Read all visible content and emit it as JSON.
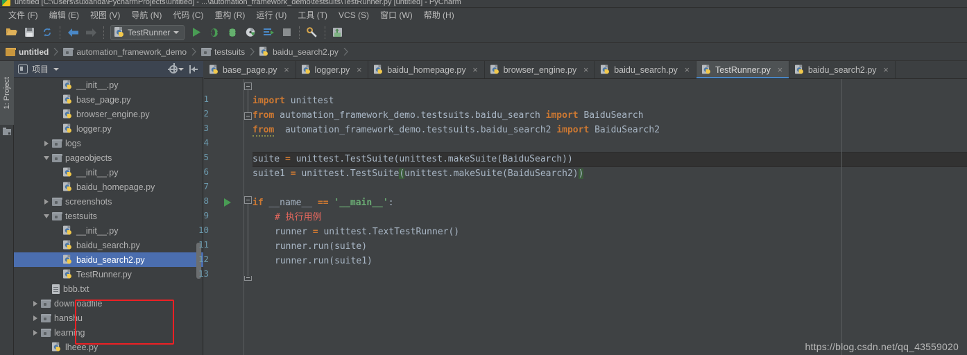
{
  "window": {
    "title": "untitled [C:\\Users\\suxianda\\PycharmProjects\\untitled] - ...\\automation_framework_demo\\testsuits\\TestRunner.py [untitled] - PyCharm",
    "logo_icon": "pycharm-logo-icon"
  },
  "menubar": {
    "items": [
      {
        "label": "文件 (F)"
      },
      {
        "label": "编辑 (E)"
      },
      {
        "label": "视图 (V)"
      },
      {
        "label": "导航 (N)"
      },
      {
        "label": "代码 (C)"
      },
      {
        "label": "重构 (R)"
      },
      {
        "label": "运行 (U)"
      },
      {
        "label": "工具 (T)"
      },
      {
        "label": "VCS (S)"
      },
      {
        "label": "窗口 (W)"
      },
      {
        "label": "帮助 (H)"
      }
    ]
  },
  "toolbar": {
    "run_config": {
      "label": "TestRunner",
      "icon": "python-file-icon",
      "caret": "chevron-down-icon"
    },
    "buttons": [
      {
        "name": "open-folder-icon"
      },
      {
        "name": "save-all-icon"
      },
      {
        "name": "sync-refresh-icon"
      },
      {
        "name": "back-arrow-icon"
      },
      {
        "name": "forward-arrow-icon"
      },
      {
        "name": "run-icon"
      },
      {
        "name": "debug-icon"
      },
      {
        "name": "coverage-icon"
      },
      {
        "name": "profile-icon"
      },
      {
        "name": "run-with-console-icon"
      },
      {
        "name": "stop-icon"
      },
      {
        "name": "settings-wrench-icon"
      },
      {
        "name": "vcs-update-icon"
      }
    ]
  },
  "breadcrumb": {
    "items": [
      {
        "label": "untitled",
        "icon": "folder-open-icon"
      },
      {
        "label": "automation_framework_demo",
        "icon": "folder-icon"
      },
      {
        "label": "testsuits",
        "icon": "folder-icon"
      },
      {
        "label": "baidu_search2.py",
        "icon": "python-file-icon"
      }
    ]
  },
  "toolstrip": {
    "project_button": "1: Project",
    "project_button_num": "1",
    "project_button_rest": ": Project",
    "structure_icon": "folder-tool-icon"
  },
  "project_panel": {
    "title": "项目",
    "header_icon": "project-view-icon",
    "gear_icon": "gear-icon",
    "collapse_icon": "collapse-all-icon",
    "tree": [
      {
        "label": "__init__.py",
        "icon": "python-file-icon",
        "indent": 4,
        "twisty": "none",
        "selected": false
      },
      {
        "label": "base_page.py",
        "icon": "python-file-icon",
        "indent": 4,
        "twisty": "none",
        "selected": false
      },
      {
        "label": "browser_engine.py",
        "icon": "python-file-icon",
        "indent": 4,
        "twisty": "none",
        "selected": false
      },
      {
        "label": "logger.py",
        "icon": "python-file-icon",
        "indent": 4,
        "twisty": "none",
        "selected": false
      },
      {
        "label": "logs",
        "icon": "folder-icon",
        "indent": 3,
        "twisty": "right",
        "selected": false
      },
      {
        "label": "pageobjects",
        "icon": "folder-icon",
        "indent": 3,
        "twisty": "down",
        "selected": false
      },
      {
        "label": "__init__.py",
        "icon": "python-file-icon",
        "indent": 4,
        "twisty": "none",
        "selected": false
      },
      {
        "label": "baidu_homepage.py",
        "icon": "python-file-icon",
        "indent": 4,
        "twisty": "none",
        "selected": false
      },
      {
        "label": "screenshots",
        "icon": "folder-icon",
        "indent": 3,
        "twisty": "right",
        "selected": false
      },
      {
        "label": "testsuits",
        "icon": "folder-icon",
        "indent": 3,
        "twisty": "down",
        "selected": false
      },
      {
        "label": "__init__.py",
        "icon": "python-file-icon",
        "indent": 4,
        "twisty": "none",
        "selected": false
      },
      {
        "label": "baidu_search.py",
        "icon": "python-file-icon",
        "indent": 4,
        "twisty": "none",
        "selected": false
      },
      {
        "label": "baidu_search2.py",
        "icon": "python-file-icon",
        "indent": 4,
        "twisty": "none",
        "selected": true
      },
      {
        "label": "TestRunner.py",
        "icon": "python-file-icon",
        "indent": 4,
        "twisty": "none",
        "selected": false
      },
      {
        "label": "bbb.txt",
        "icon": "text-file-icon",
        "indent": 3,
        "twisty": "none",
        "selected": false
      },
      {
        "label": "downloadfile",
        "icon": "folder-icon",
        "indent": 2,
        "twisty": "right",
        "selected": false
      },
      {
        "label": "hanshu",
        "icon": "folder-icon",
        "indent": 2,
        "twisty": "right",
        "selected": false
      },
      {
        "label": "learning",
        "icon": "folder-icon",
        "indent": 2,
        "twisty": "right",
        "selected": false
      },
      {
        "label": "lheee.py",
        "icon": "python-file-icon",
        "indent": 3,
        "twisty": "none",
        "selected": false
      }
    ],
    "annotation": {
      "color": "#ed2024",
      "name": "red-highlight-box"
    }
  },
  "editor_tabs": [
    {
      "label": "base_page.py",
      "icon": "python-file-icon",
      "active": false,
      "close": "×"
    },
    {
      "label": "logger.py",
      "icon": "python-file-icon",
      "active": false,
      "close": "×"
    },
    {
      "label": "baidu_homepage.py",
      "icon": "python-file-icon",
      "active": false,
      "close": "×"
    },
    {
      "label": "browser_engine.py",
      "icon": "python-file-icon",
      "active": false,
      "close": "×"
    },
    {
      "label": "baidu_search.py",
      "icon": "python-file-icon",
      "active": false,
      "close": "×"
    },
    {
      "label": "TestRunner.py",
      "icon": "python-file-icon",
      "active": true,
      "close": "×"
    },
    {
      "label": "baidu_search2.py",
      "icon": "python-file-icon",
      "active": false,
      "close": "×"
    }
  ],
  "editor": {
    "line_numbers": [
      "1",
      "2",
      "3",
      "4",
      "5",
      "6",
      "7",
      "8",
      "9",
      "10",
      "11",
      "12",
      "13"
    ],
    "current_line": 6,
    "run_marker_line": 8,
    "lines": [
      {
        "n": 1,
        "text": "import unittest"
      },
      {
        "n": 2,
        "text": "from automation_framework_demo.testsuits.baidu_search import BaiduSearch"
      },
      {
        "n": 3,
        "text": "from  automation_framework_demo.testsuits.baidu_search2 import BaiduSearch2"
      },
      {
        "n": 4,
        "text": ""
      },
      {
        "n": 5,
        "text": "suite = unittest.TestSuite(unittest.makeSuite(BaiduSearch))"
      },
      {
        "n": 6,
        "text": "suite1 = unittest.TestSuite(unittest.makeSuite(BaiduSearch2))"
      },
      {
        "n": 7,
        "text": ""
      },
      {
        "n": 8,
        "text": "if __name__ == '__main__':"
      },
      {
        "n": 9,
        "text": "    # 执行用例"
      },
      {
        "n": 10,
        "text": "    runner = unittest.TextTestRunner()"
      },
      {
        "n": 11,
        "text": "    runner.run(suite)"
      },
      {
        "n": 12,
        "text": "    runner.run(suite1)"
      },
      {
        "n": 13,
        "text": ""
      }
    ],
    "tokens": {
      "import": "import",
      "from": "from",
      "if": "if",
      "unittest": "unittest",
      "module2": "automation_framework_demo.testsuits.baidu_search",
      "class2": "BaiduSearch",
      "module3": "automation_framework_demo.testsuits.baidu_search2",
      "class3": "BaiduSearch2",
      "suite_name": "suite",
      "suite1_name": "suite1",
      "eq": "=",
      "testsuite_call": "unittest.TestSuite",
      "makesuite_call_a": "unittest.makeSuite(BaiduSearch)",
      "makesuite_call_b": "unittest.makeSuite(BaiduSearch2)",
      "dunder_name": "__name__",
      "eqeq": "==",
      "main_str": "'__main__'",
      "colon": ":",
      "comment9": "# 执行用例",
      "runner_name": "runner",
      "texttestrunner": "unittest.TextTestRunner()",
      "run_suite": "runner.run(suite)",
      "run_suite1": "runner.run(suite1)",
      "lparen": "(",
      "rparen": ")"
    }
  },
  "watermark": "https://blog.csdn.net/qq_43559020",
  "colors": {
    "bg_chrome": "#3c3f41",
    "editor_bg": "#3f4244",
    "selection_blue": "#4b6eaf",
    "tab_active": "#4e5254",
    "annotation_red": "#ed2024",
    "keyword_orange": "#cc7832",
    "string_green": "#6a8759",
    "comment_red": "#e8685e",
    "linenum_blue": "#6c9aae",
    "run_green": "#499c54"
  }
}
